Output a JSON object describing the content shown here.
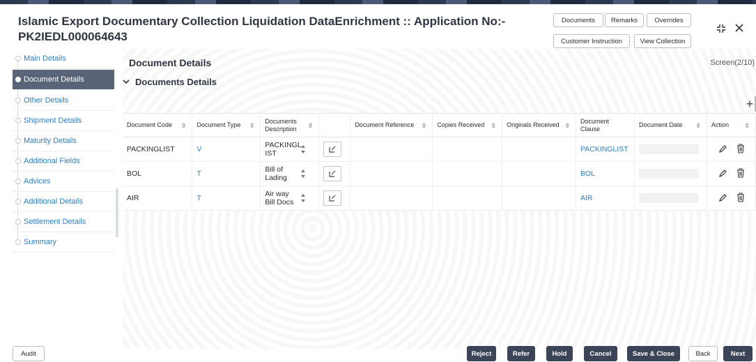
{
  "app": {
    "title": "Islamic Export Documentary Collection Liquidation DataEnrichment :: Application No:- PK2IEDL000064643",
    "header_buttons": [
      "Documents",
      "Remarks",
      "Overrides",
      "Customer Instruction",
      "View Collection"
    ],
    "window_icons": [
      "collapse-icon",
      "close-icon"
    ]
  },
  "sidebar": {
    "items": [
      {
        "label": "Main Details"
      },
      {
        "label": "Document Details"
      },
      {
        "label": "Other Details"
      },
      {
        "label": "Shipment Details"
      },
      {
        "label": "Maturity Details"
      },
      {
        "label": "Additional Fields"
      },
      {
        "label": "Advices"
      },
      {
        "label": "Additional Details"
      },
      {
        "label": "Settlement Details"
      },
      {
        "label": "Summary"
      }
    ],
    "active": "Document Details"
  },
  "main": {
    "title": "Document Details",
    "screen_indicator": "Screen(2/10)",
    "section_title": "Documents Details",
    "add_symbol": "+"
  },
  "table": {
    "columns": [
      {
        "label": "Document Code",
        "sortable": true
      },
      {
        "label": "Document Type",
        "sortable": true
      },
      {
        "label": "Documents Description",
        "sortable": true
      },
      {
        "label": "",
        "sortable": false
      },
      {
        "label": "Document Reference",
        "sortable": true
      },
      {
        "label": "Copies Received",
        "sortable": true
      },
      {
        "label": "Originals Received",
        "sortable": true
      },
      {
        "label": "Document Clause",
        "sortable": false
      },
      {
        "label": "Document Date",
        "sortable": true
      },
      {
        "label": "Action",
        "sortable": true
      }
    ],
    "rows": [
      {
        "code": "PACKINGLIST",
        "type": "V",
        "description": "PACKINGL IST",
        "reference": "",
        "copies": "",
        "originals": "",
        "clause": "PACKINGLIST",
        "date": ""
      },
      {
        "code": "BOL",
        "type": "T",
        "description": "Bill of Lading",
        "reference": "",
        "copies": "",
        "originals": "",
        "clause": "BOL",
        "date": ""
      },
      {
        "code": "AIR",
        "type": "T",
        "description": "Air way Bill Docs",
        "reference": "",
        "copies": "",
        "originals": "",
        "clause": "AIR",
        "date": ""
      }
    ]
  },
  "footer": {
    "left_button": "Audit",
    "buttons": [
      "Reject",
      "Refer",
      "Hold",
      "Cancel",
      "Save & Close",
      "Back",
      "Next"
    ]
  },
  "colors": {
    "accent_link": "#2e7ec2",
    "sidebar_active": "#5a6479",
    "footer_dark_button": "#3c4457"
  }
}
